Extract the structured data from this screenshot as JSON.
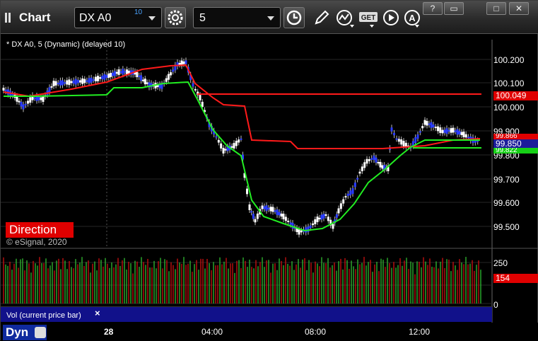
{
  "app": {
    "title": "Chart"
  },
  "toolbar": {
    "symbol": "DX A0",
    "symbol_delay": "10",
    "interval": "5",
    "window_buttons": [
      "?",
      "▭",
      "□",
      "✕"
    ]
  },
  "chart": {
    "info": "* DX A0, 5 (Dynamic) (delayed 10)",
    "direction_label": "Direction",
    "copyright": "© eSignal, 2020",
    "price_labels": [
      "100.200",
      "100.100",
      "100.000",
      "99.900",
      "99.800",
      "99.700",
      "99.600",
      "99.500"
    ],
    "tags": {
      "red_line": "100.049",
      "last_price": "99.850",
      "hidden_top": "99.866",
      "green_line": "99.822"
    },
    "volume_labels": [
      "250",
      "0"
    ],
    "volume_tag": "154",
    "volume_panel_label": "Vol (current price bar)",
    "time_labels": [
      "28",
      "04:00",
      "08:00",
      "12:00"
    ],
    "mode_label": "Dyn",
    "colors": {
      "up": "#ffffff",
      "down": "#2a3cff",
      "red_ma": "#ff1a1a",
      "green_ma": "#22ee22",
      "vol_green": "#2fae2f",
      "vol_red": "#c01010"
    }
  }
}
